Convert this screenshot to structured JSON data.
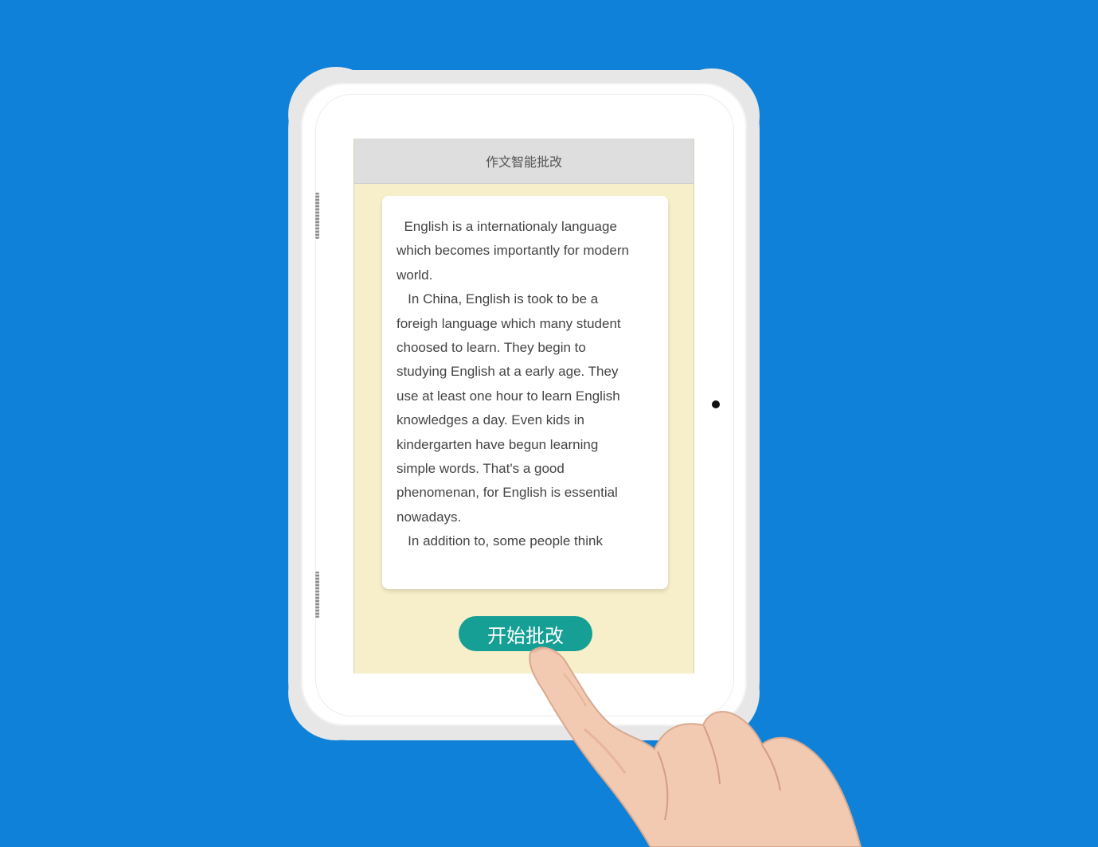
{
  "colors": {
    "background": "#0f81d8",
    "screen_background": "#f7efc9",
    "header_background": "#dedede",
    "button_background": "#169f94",
    "button_text": "#ffffff"
  },
  "app": {
    "title": "作文智能批改"
  },
  "essay": {
    "text": "  English is a internationaly language\nwhich becomes importantly for modern\nworld.\n   In China, English is took to be a\nforeigh language which many student\nchoosed to learn. They begin to\nstudying English at a early age. They\nuse at least one hour to learn English\nknowledges a day. Even kids in\nkindergarten have begun learning\nsimple words. That's a good\nphenomenan, for English is essential\nnowadays.\n   In addition to, some people think"
  },
  "actions": {
    "start_grading_label": "开始批改"
  },
  "icons": {
    "camera": "camera-dot-icon",
    "hand": "pointing-hand-icon"
  }
}
